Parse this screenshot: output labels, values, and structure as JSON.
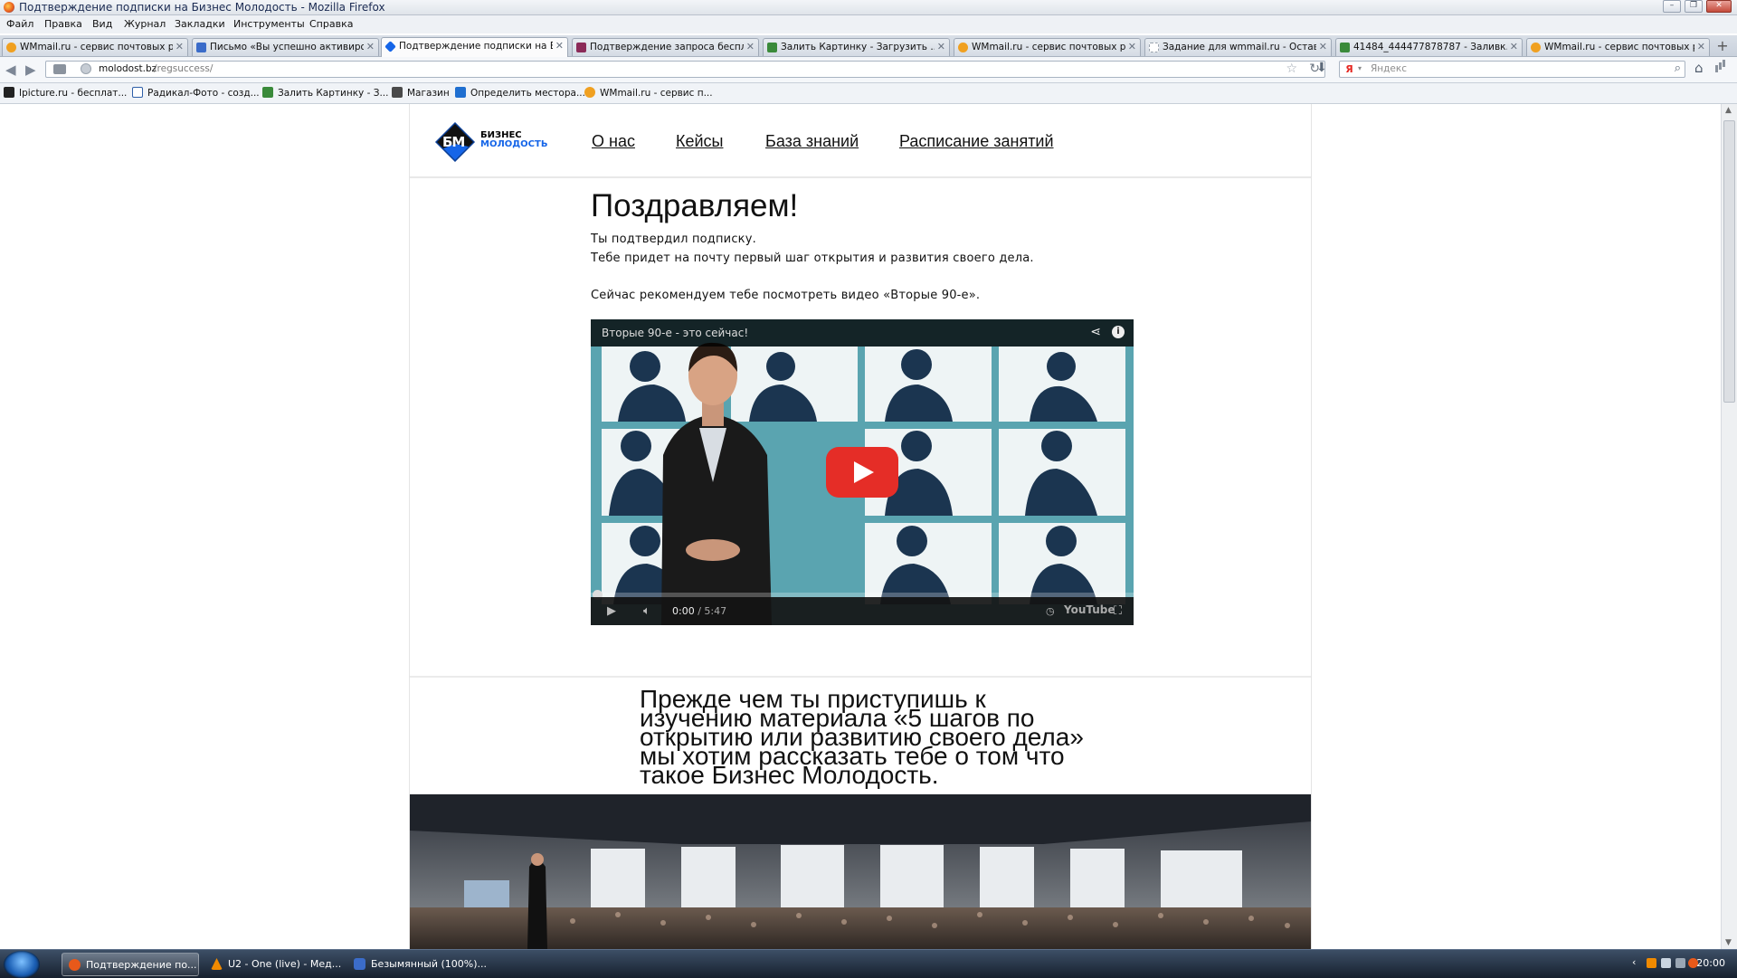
{
  "window": {
    "title": "Подтверждение подписки на Бизнес Молодость - Mozilla Firefox",
    "controls": [
      "–",
      "❐",
      "✕"
    ]
  },
  "menu": [
    "Файл",
    "Правка",
    "Вид",
    "Журнал",
    "Закладки",
    "Инструменты",
    "Справка"
  ],
  "tabs": [
    {
      "label": "WMmail.ru - сервис почтовых р...",
      "icon_color": "#f0a020",
      "active": false
    },
    {
      "label": "Письмо «Вы успешно активиро...",
      "icon_color": "#3b6cc9",
      "active": false
    },
    {
      "label": "Подтверждение подписки на Б...",
      "icon_color": "#1565e8",
      "active": true
    },
    {
      "label": "Подтверждение запроса беспл...",
      "icon_color": "#8b2a58",
      "active": false
    },
    {
      "label": "Залить Картинку - Загрузить ...",
      "icon_color": "#3a8a3a",
      "active": false
    },
    {
      "label": "WMmail.ru - сервис почтовых р...",
      "icon_color": "#f0a020",
      "active": false
    },
    {
      "label": "Задание для wmmail.ru - Остав...",
      "icon_color": "#cfd4da",
      "active": false
    },
    {
      "label": "41484_444477878787 - Заливк...",
      "icon_color": "#3a8a3a",
      "active": false
    },
    {
      "label": "WMmail.ru - сервис почтовых р...",
      "icon_color": "#f0a020",
      "active": false
    }
  ],
  "newtab_label": "+",
  "nav": {
    "url_host": "molodost.bz",
    "url_path": "/regsuccess/",
    "search_placeholder": "Яндекс",
    "search_engine_letter": "Я"
  },
  "bookmarks": [
    {
      "label": "Ipicture.ru - бесплат...",
      "icon_color": "#222222"
    },
    {
      "label": "Радикал-Фото - созд...",
      "icon_color": "#2f5fa8"
    },
    {
      "label": "Залить Картинку - З...",
      "icon_color": "#3a8a3a"
    },
    {
      "label": "Магазин",
      "icon_color": "#4a4a4a"
    },
    {
      "label": "Определить местора...",
      "icon_color": "#1f6fd0"
    },
    {
      "label": "WMmail.ru - сервис п...",
      "icon_color": "#f0a020"
    }
  ],
  "site": {
    "logo_initials": "БМ",
    "logo_line1": "БИЗНЕС",
    "logo_line2": "МОЛОДОСТЬ",
    "nav": [
      "О нас",
      "Кейсы",
      "База знаний",
      "Расписание занятий"
    ],
    "heading": "Поздравляем!",
    "line1": "Ты подтвердил подписку.",
    "line2": "Тебе придет на почту первый шаг открытия и развития своего дела.",
    "line3": "Сейчас рекомендуем тебе посмотреть видео «Вторые 90-е».",
    "subtitle": "Прежде чем ты приступишь к изучению материала «5 шагов по открытию или развитию своего дела» мы хотим рассказать тебе о том что такое Бизнес Молодость."
  },
  "video": {
    "title": "Вторые 90-е - это сейчас!",
    "current_time": "0:00",
    "duration": "/ 5:47",
    "brand": "YouTube",
    "progress": 0.0
  },
  "taskbar": {
    "items": [
      {
        "label": "Подтверждение по...",
        "icon_color": "#e8591a",
        "active": true
      },
      {
        "label": "U2 - One (live) - Мед...",
        "icon_color": "#f08a00",
        "active": false
      },
      {
        "label": "Безымянный (100%)...",
        "icon_color": "#3b6cc9",
        "active": false
      }
    ],
    "clock": "20:00"
  }
}
